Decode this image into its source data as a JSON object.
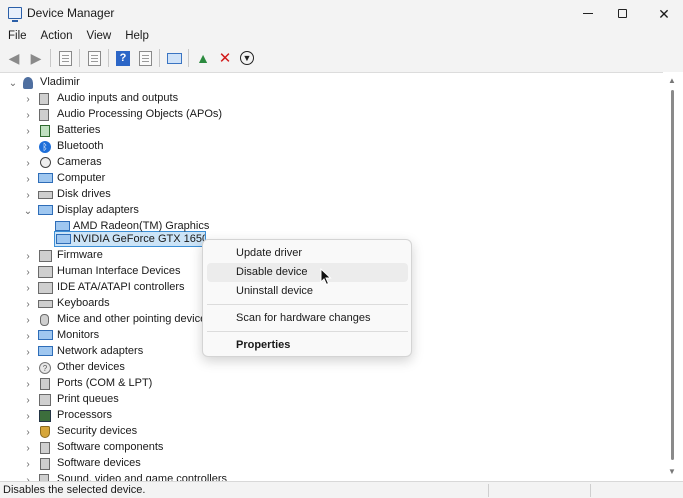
{
  "window": {
    "title": "Device Manager"
  },
  "menu": [
    "File",
    "Action",
    "View",
    "Help"
  ],
  "toolbar": {
    "buttons": [
      "back-icon",
      "forward-icon",
      "properties-pane-icon",
      "console-tree-icon",
      "help-icon",
      "run-icon",
      "scan-hardware-icon",
      "update-driver-icon",
      "uninstall-icon",
      "disable-icon"
    ]
  },
  "tree": {
    "root": "Vladimir",
    "categories": [
      {
        "label": "Audio inputs and outputs",
        "icon": "speaker-icon"
      },
      {
        "label": "Audio Processing Objects (APOs)",
        "icon": "speaker-icon"
      },
      {
        "label": "Batteries",
        "icon": "battery-icon"
      },
      {
        "label": "Bluetooth",
        "icon": "bluetooth-icon"
      },
      {
        "label": "Cameras",
        "icon": "camera-icon"
      },
      {
        "label": "Computer",
        "icon": "computer-icon"
      },
      {
        "label": "Disk drives",
        "icon": "disk-icon"
      },
      {
        "label": "Display adapters",
        "icon": "display-adapter-icon",
        "expanded": true,
        "children": [
          {
            "label": "AMD Radeon(TM) Graphics",
            "icon": "display-adapter-icon"
          },
          {
            "label": "NVIDIA GeForce GTX 1650 Ti",
            "icon": "display-adapter-icon",
            "selected": true
          }
        ]
      },
      {
        "label": "Firmware",
        "icon": "firmware-icon"
      },
      {
        "label": "Human Interface Devices",
        "icon": "hid-icon"
      },
      {
        "label": "IDE ATA/ATAPI controllers",
        "icon": "ide-icon"
      },
      {
        "label": "Keyboards",
        "icon": "keyboard-icon"
      },
      {
        "label": "Mice and other pointing devices",
        "icon": "mouse-icon"
      },
      {
        "label": "Monitors",
        "icon": "monitor-icon"
      },
      {
        "label": "Network adapters",
        "icon": "network-icon"
      },
      {
        "label": "Other devices",
        "icon": "unknown-device-icon"
      },
      {
        "label": "Ports (COM & LPT)",
        "icon": "port-icon"
      },
      {
        "label": "Print queues",
        "icon": "printer-icon"
      },
      {
        "label": "Processors",
        "icon": "processor-icon"
      },
      {
        "label": "Security devices",
        "icon": "security-icon"
      },
      {
        "label": "Software components",
        "icon": "software-icon"
      },
      {
        "label": "Software devices",
        "icon": "software-icon"
      },
      {
        "label": "Sound, video and game controllers",
        "icon": "speaker-icon"
      }
    ]
  },
  "context_menu": {
    "items": [
      "Update driver",
      "Disable device",
      "Uninstall device",
      "Scan for hardware changes",
      "Properties"
    ],
    "hovered": "Disable device"
  },
  "status": {
    "text": "Disables the selected device."
  }
}
